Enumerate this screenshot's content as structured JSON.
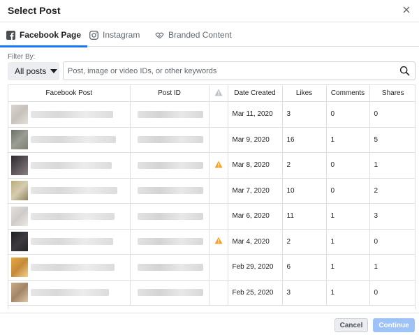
{
  "dialog": {
    "title": "Select Post"
  },
  "tabs": [
    {
      "label": "Facebook Page",
      "icon": "facebook-icon",
      "active": true
    },
    {
      "label": "Instagram",
      "icon": "instagram-icon",
      "active": false
    },
    {
      "label": "Branded Content",
      "icon": "handshake-icon",
      "active": false
    }
  ],
  "filter": {
    "label": "Filter By:",
    "dropdown_value": "All posts",
    "search_placeholder": "Post, image or video IDs, or other keywords"
  },
  "table": {
    "headers": [
      "Facebook Post",
      "Post ID",
      "",
      "Date Created",
      "Likes",
      "Comments",
      "Shares"
    ],
    "rows": [
      {
        "date": "Mar 11, 2020",
        "likes": "3",
        "comments": "0",
        "shares": "0",
        "warning": false
      },
      {
        "date": "Mar 9, 2020",
        "likes": "16",
        "comments": "1",
        "shares": "5",
        "warning": false
      },
      {
        "date": "Mar 8, 2020",
        "likes": "2",
        "comments": "0",
        "shares": "1",
        "warning": true
      },
      {
        "date": "Mar 7, 2020",
        "likes": "10",
        "comments": "0",
        "shares": "2",
        "warning": false
      },
      {
        "date": "Mar 6, 2020",
        "likes": "11",
        "comments": "1",
        "shares": "3",
        "warning": false
      },
      {
        "date": "Mar 4, 2020",
        "likes": "2",
        "comments": "1",
        "shares": "0",
        "warning": true
      },
      {
        "date": "Feb 29, 2020",
        "likes": "6",
        "comments": "1",
        "shares": "1",
        "warning": false
      },
      {
        "date": "Feb 25, 2020",
        "likes": "3",
        "comments": "1",
        "shares": "0",
        "warning": false
      }
    ]
  },
  "footer": {
    "cancel_label": "Cancel",
    "continue_label": "Continue"
  },
  "colors": {
    "accent": "#1877f2",
    "continue_disabled": "#9cc2f7",
    "warning": "#f7a128"
  }
}
